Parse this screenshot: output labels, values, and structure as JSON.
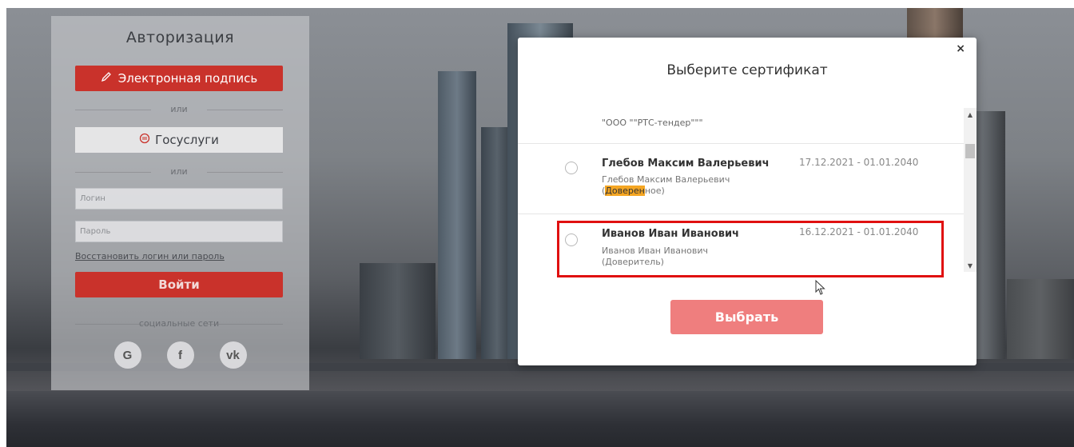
{
  "login": {
    "title": "Авторизация",
    "esign_label": "Электронная подпись",
    "or1": "или",
    "gosuslugi_label": "Госуслуги",
    "or2": "или",
    "login_placeholder": "Логин",
    "password_placeholder": "Пароль",
    "restore_link": "Восстановить логин или пароль",
    "login_button": "Войти",
    "social_label": "социальные сети",
    "social": [
      {
        "name": "google",
        "glyph": "G"
      },
      {
        "name": "facebook",
        "glyph": "f"
      },
      {
        "name": "vk",
        "glyph": "vk"
      }
    ]
  },
  "modal": {
    "close_glyph": "×",
    "title": "Выберите сертификат",
    "top_fragment": "\"ООО \"\"РТС-тендер\"\"\"",
    "certificates": [
      {
        "name": "Глебов Максим Валерьевич",
        "sub_line1": "Глебов Максим Валерьевич",
        "sub_highlight": "Доверен",
        "sub_rest": "ное)",
        "sub_open": "(",
        "dates": "17.12.2021 - 01.01.2040"
      },
      {
        "name": "Иванов Иван Иванович",
        "sub_line1": "Иванов Иван Иванович",
        "sub_line2": "(Доверитель)",
        "dates": "16.12.2021 - 01.01.2040"
      }
    ],
    "select_button": "Выбрать"
  },
  "colors": {
    "accent_red": "#c9322b",
    "select_button": "#ef7e7e",
    "highlight_border": "#e01010",
    "search_highlight": "#f5a623"
  }
}
